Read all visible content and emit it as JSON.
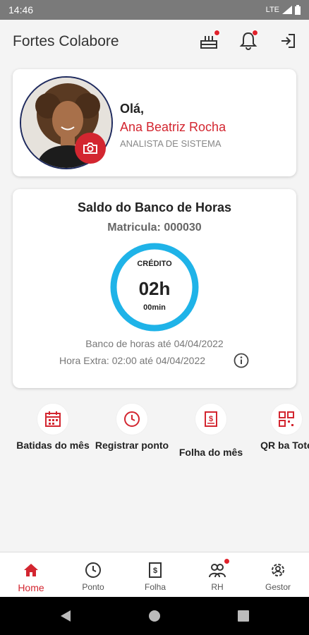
{
  "status": {
    "time": "14:46",
    "network": "LTE"
  },
  "app": {
    "title": "Fortes Colabore"
  },
  "profile": {
    "greeting": "Olá,",
    "name": "Ana Beatriz Rocha",
    "role": "ANALISTA DE SISTEMA"
  },
  "balance": {
    "title": "Saldo do Banco de Horas",
    "matricula": "Matricula: 000030",
    "ring_label": "CRÉDITO",
    "hours": "02h",
    "minutes": "00min",
    "bank_until": "Banco de horas até 04/04/2022",
    "overtime": "Hora Extra: 02:00 até 04/04/2022"
  },
  "shortcuts": [
    {
      "label": "Batidas do mês",
      "icon": "calendar-icon"
    },
    {
      "label": "Registrar ponto",
      "icon": "clock-icon"
    },
    {
      "label": "Folha do mês",
      "icon": "payslip-icon"
    },
    {
      "label": "QR ba Tote",
      "icon": "qr-code-icon"
    }
  ],
  "nav": [
    {
      "label": "Home",
      "icon": "home-icon",
      "active": true
    },
    {
      "label": "Ponto",
      "icon": "clock-icon"
    },
    {
      "label": "Folha",
      "icon": "payslip-icon"
    },
    {
      "label": "RH",
      "icon": "people-icon"
    },
    {
      "label": "Gestor",
      "icon": "manager-gear-icon"
    }
  ],
  "colors": {
    "accent": "#d32630",
    "ring": "#1fb3e8"
  }
}
